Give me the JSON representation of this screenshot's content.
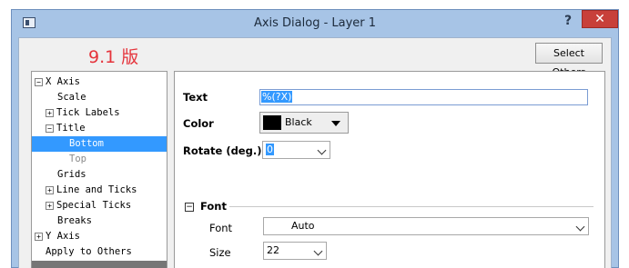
{
  "window": {
    "title": "Axis Dialog - Layer 1",
    "help": "?",
    "close": "✕"
  },
  "version_label": "9.1 版",
  "select_others": "Select Others",
  "tree": {
    "items": [
      {
        "label": "X Axis",
        "toggle": "⊟"
      },
      {
        "label": "Scale"
      },
      {
        "label": "Tick Labels",
        "toggle": "⊞"
      },
      {
        "label": "Title",
        "toggle": "⊟"
      },
      {
        "label": "Bottom"
      },
      {
        "label": "Top"
      },
      {
        "label": "Grids"
      },
      {
        "label": "Line and Ticks",
        "toggle": "⊞"
      },
      {
        "label": "Special Ticks",
        "toggle": "⊞"
      },
      {
        "label": "Breaks"
      },
      {
        "label": "Y Axis",
        "toggle": "⊞"
      },
      {
        "label": "Apply to Others"
      }
    ]
  },
  "panel": {
    "text_label": "Text",
    "text_value": "%(?X)",
    "color_label": "Color",
    "color_value": "Black",
    "color_swatch": "#000000",
    "rotate_label": "Rotate (deg.)",
    "rotate_value": "0",
    "font_section": "Font",
    "font_section_toggle": "−",
    "font_label": "Font",
    "font_value": "Auto",
    "size_label": "Size",
    "size_value": "22"
  },
  "colors": {
    "accent_red": "#e5333b",
    "selection": "#3399ff",
    "close_button": "#c8403a",
    "title_bar": "#a7c4e6"
  }
}
